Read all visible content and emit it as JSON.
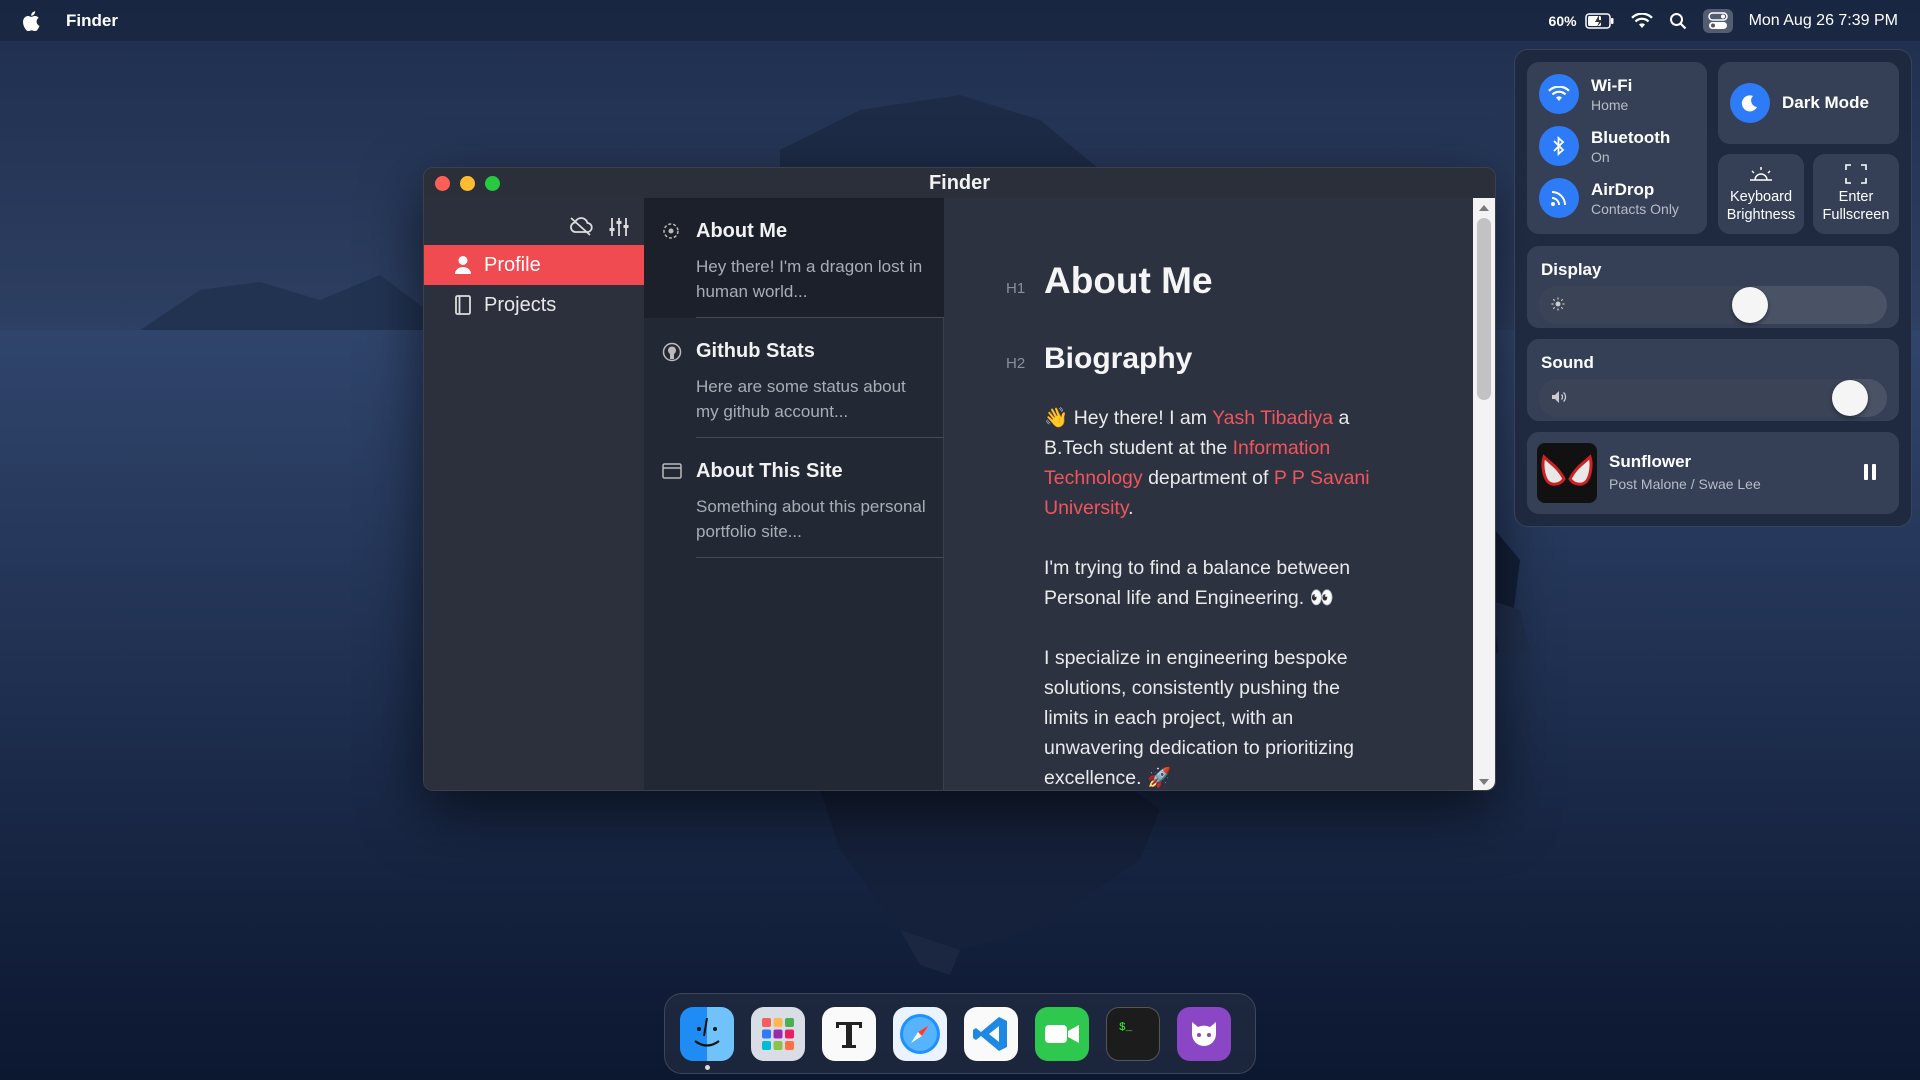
{
  "menubar": {
    "app_name": "Finder",
    "battery_percent": "60%",
    "clock": "Mon Aug 26 7:39 PM",
    "icons": [
      "apple-icon",
      "battery-icon",
      "wifi-icon",
      "search-icon",
      "control-center-icon"
    ]
  },
  "window": {
    "title": "Finder",
    "sidebar": {
      "items": [
        {
          "label": "Profile",
          "icon": "person-icon",
          "active": true
        },
        {
          "label": "Projects",
          "icon": "book-icon",
          "active": false
        }
      ]
    },
    "list": {
      "items": [
        {
          "title": "About Me",
          "description": "Hey there! I'm a dragon lost in human world...",
          "icon": "ring-icon"
        },
        {
          "title": "Github Stats",
          "description": "Here are some status about my github account...",
          "icon": "github-icon"
        },
        {
          "title": "About This Site",
          "description": "Something about this personal portfolio site...",
          "icon": "window-icon"
        }
      ]
    },
    "content": {
      "h1_tag": "H1",
      "h1": "About Me",
      "h2_tag": "H2",
      "h2": "Biography",
      "bio": {
        "emoji": "👋",
        "t1": " Hey there! I am ",
        "name": "Yash Tibadiya",
        "t2": " a B.Tech student at the ",
        "dept": "Information Technology",
        "t3": " department of ",
        "uni": "P P Savani University",
        "t4": "."
      },
      "para2": "I'm trying to find a balance between Personal life and Engineering.",
      "para2_emoji": "👀",
      "para3": "I specialize in engineering bespoke solutions, consistently pushing the limits in each project, with an unwavering dedication to prioritizing excellence.",
      "para3_emoji": "🚀"
    }
  },
  "control_center": {
    "wifi": {
      "label": "Wi-Fi",
      "sub": "Home"
    },
    "bluetooth": {
      "label": "Bluetooth",
      "sub": "On"
    },
    "airdrop": {
      "label": "AirDrop",
      "sub": "Contacts Only"
    },
    "dark_mode": {
      "label": "Dark Mode"
    },
    "keyboard": {
      "line1": "Keyboard",
      "line2": "Brightness"
    },
    "fullscreen": {
      "line1": "Enter",
      "line2": "Fullscreen"
    },
    "display": {
      "label": "Display",
      "level": 0.62
    },
    "sound": {
      "label": "Sound",
      "level": 0.94
    },
    "now_playing": {
      "title": "Sunflower",
      "artist": "Post Malone / Swae Lee"
    }
  },
  "dock": {
    "apps": [
      "finder-icon",
      "launchpad-icon",
      "typora-icon",
      "safari-icon",
      "vscode-icon",
      "facetime-icon",
      "terminal-icon",
      "github-desktop-icon"
    ]
  },
  "colors": {
    "accent": "#ef4b50",
    "link": "#f2545b",
    "cc_blue": "#2d7bf6"
  }
}
